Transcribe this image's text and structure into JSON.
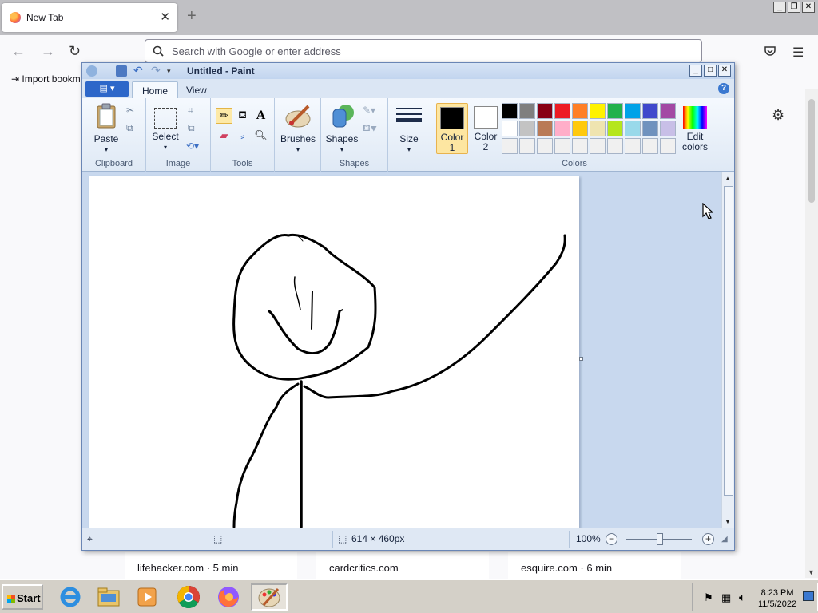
{
  "browser": {
    "tab_title": "New Tab",
    "close_tab": "✕",
    "new_tab": "+",
    "address_placeholder": "Search with Google or enter address",
    "bookmark_import": "Import bookma",
    "window_controls": [
      "_",
      "❐",
      "✕"
    ],
    "top_sites": [
      {
        "label": "lifehacker.com · 5 min"
      },
      {
        "label": "cardcritics.com"
      },
      {
        "label": "esquire.com · 6 min"
      }
    ]
  },
  "paint": {
    "window_title": "Untitled - Paint",
    "window_controls": [
      "_",
      "□",
      "✕"
    ],
    "tabs": [
      {
        "label": "Home",
        "active": true
      },
      {
        "label": "View",
        "active": false
      }
    ],
    "help": "?",
    "groups": {
      "clipboard": {
        "label": "Clipboard",
        "paste": "Paste"
      },
      "image": {
        "label": "Image",
        "select": "Select"
      },
      "tools": {
        "label": "Tools"
      },
      "brushes": {
        "label": "Brushes"
      },
      "shapes": {
        "label": "Shapes",
        "shapes_btn": "Shapes"
      },
      "size": {
        "label": "Size"
      },
      "colors": {
        "label": "Colors",
        "color1_line1": "Color",
        "color1_line2": "1",
        "color2_line1": "Color",
        "color2_line2": "2",
        "edit_line1": "Edit",
        "edit_line2": "colors",
        "color1": "#000000",
        "color2": "#ffffff",
        "palette": [
          "#000000",
          "#7f7f7f",
          "#880015",
          "#ed1c24",
          "#ff7f27",
          "#fff200",
          "#22b14c",
          "#00a2e8",
          "#3f48cc",
          "#a349a4",
          "#ffffff",
          "#c3c3c3",
          "#b97a57",
          "#ffaec9",
          "#ffc90e",
          "#efe4b0",
          "#b5e61d",
          "#99d9ea",
          "#7092be",
          "#c8bfe7",
          "#f0f0f0",
          "#f0f0f0",
          "#f0f0f0",
          "#f0f0f0",
          "#f0f0f0",
          "#f0f0f0",
          "#f0f0f0",
          "#f0f0f0",
          "#f0f0f0",
          "#f0f0f0"
        ]
      }
    },
    "status": {
      "image_size": "614 × 460px",
      "zoom": "100%",
      "zoom_out": "−",
      "zoom_in": "+"
    }
  },
  "taskbar": {
    "start": "Start",
    "time": "8:23 PM",
    "date": "11/5/2022"
  }
}
